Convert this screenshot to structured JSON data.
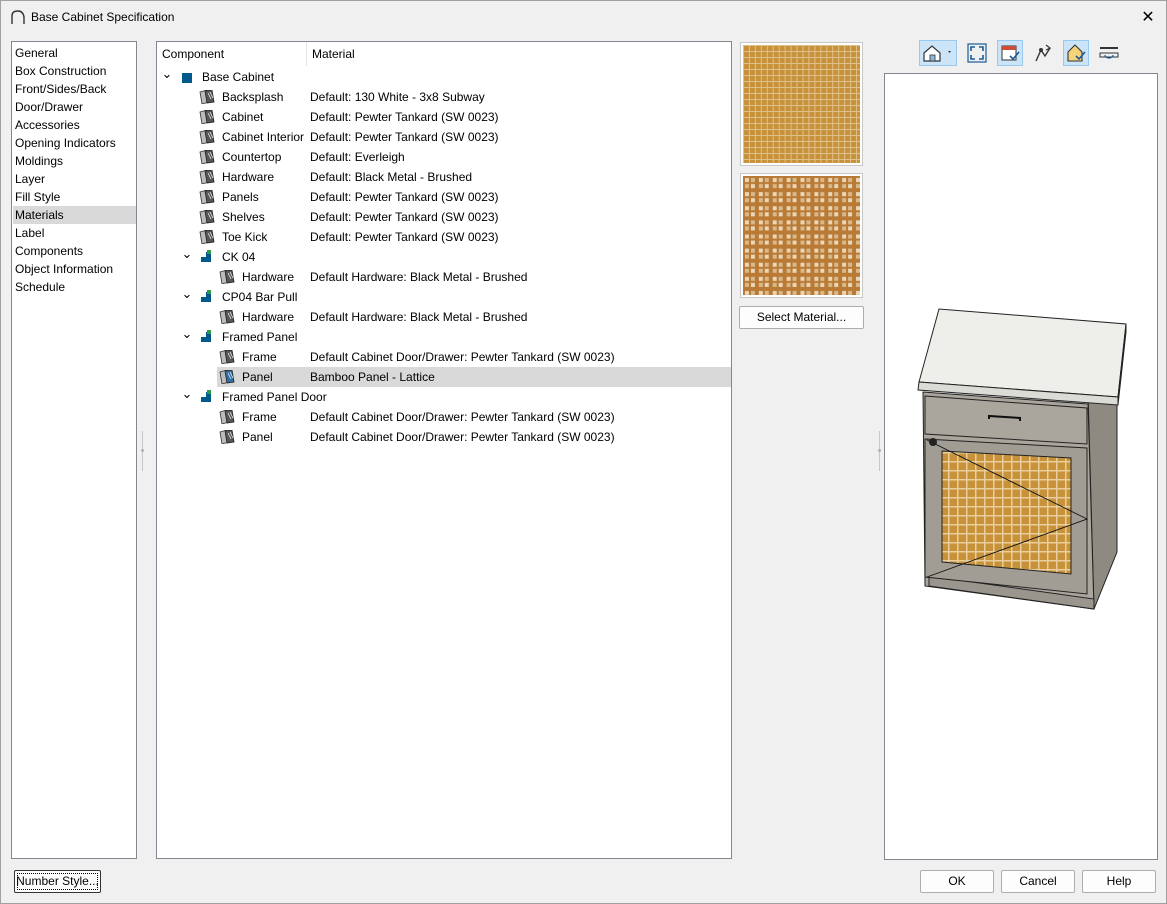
{
  "window": {
    "title": "Base Cabinet Specification",
    "close_glyph": "✕"
  },
  "nav": {
    "items": [
      {
        "label": "General"
      },
      {
        "label": "Box Construction"
      },
      {
        "label": "Front/Sides/Back"
      },
      {
        "label": "Door/Drawer"
      },
      {
        "label": "Accessories"
      },
      {
        "label": "Opening Indicators"
      },
      {
        "label": "Moldings"
      },
      {
        "label": "Layer"
      },
      {
        "label": "Fill Style"
      },
      {
        "label": "Materials",
        "selected": true
      },
      {
        "label": "Label"
      },
      {
        "label": "Components"
      },
      {
        "label": "Object Information"
      },
      {
        "label": "Schedule"
      }
    ]
  },
  "tree": {
    "columns": {
      "component": "Component",
      "material": "Material"
    },
    "rows": [
      {
        "component": "Base Cabinet",
        "material": "",
        "level": 0,
        "icon": "cabinet-icon"
      },
      {
        "component": "Backsplash",
        "material": "Default: 130 White - 3x8 Subway",
        "level": 1,
        "icon": "material-icon"
      },
      {
        "component": "Cabinet",
        "material": "Default: Pewter Tankard (SW 0023)",
        "level": 1,
        "icon": "material-icon"
      },
      {
        "component": "Cabinet Interior",
        "material": "Default: Pewter Tankard (SW 0023)",
        "level": 1,
        "icon": "material-icon"
      },
      {
        "component": "Countertop",
        "material": "Default: Everleigh",
        "level": 1,
        "icon": "material-icon"
      },
      {
        "component": "Hardware",
        "material": "Default: Black Metal - Brushed",
        "level": 1,
        "icon": "material-icon"
      },
      {
        "component": "Panels",
        "material": "Default: Pewter Tankard (SW 0023)",
        "level": 1,
        "icon": "material-icon"
      },
      {
        "component": "Shelves",
        "material": "Default: Pewter Tankard (SW 0023)",
        "level": 1,
        "icon": "material-icon"
      },
      {
        "component": "Toe Kick",
        "material": "Default: Pewter Tankard (SW 0023)",
        "level": 1,
        "icon": "material-icon"
      },
      {
        "component": "CK 04",
        "material": "",
        "level": 1,
        "icon": "component-icon",
        "expanded": true
      },
      {
        "component": "Hardware",
        "material": "Default Hardware: Black Metal - Brushed",
        "level": 2,
        "icon": "material-icon"
      },
      {
        "component": "CP04 Bar Pull",
        "material": "",
        "level": 1,
        "icon": "component-icon",
        "expanded": true
      },
      {
        "component": "Hardware",
        "material": "Default Hardware: Black Metal - Brushed",
        "level": 2,
        "icon": "material-icon"
      },
      {
        "component": "Framed Panel",
        "material": "",
        "level": 1,
        "icon": "component-icon",
        "expanded": true
      },
      {
        "component": "Frame",
        "material": "Default Cabinet Door/Drawer: Pewter Tankard (SW 0023)",
        "level": 2,
        "icon": "material-icon"
      },
      {
        "component": "Panel",
        "material": "Bamboo Panel - Lattice",
        "level": 2,
        "icon": "material-icon-blue",
        "selected": true
      },
      {
        "component": "Framed Panel Door",
        "material": "",
        "level": 1,
        "icon": "component-icon",
        "expanded": true
      },
      {
        "component": "Frame",
        "material": "Default Cabinet Door/Drawer: Pewter Tankard (SW 0023)",
        "level": 2,
        "icon": "material-icon"
      },
      {
        "component": "Panel",
        "material": "Default Cabinet Door/Drawer: Pewter Tankard (SW 0023)",
        "level": 2,
        "icon": "material-icon"
      }
    ]
  },
  "material": {
    "select_label": "Select Material..."
  },
  "preview_toolbar": {
    "buttons": [
      {
        "icon": "camera-view-dropdown-icon",
        "active": true
      },
      {
        "icon": "fill-window-icon",
        "active": false
      },
      {
        "icon": "display-options-icon",
        "active": true
      },
      {
        "icon": "rotate-view-icon",
        "active": false
      },
      {
        "icon": "show-materials-icon",
        "active": true
      },
      {
        "icon": "elevation-icon",
        "active": false
      }
    ]
  },
  "footer": {
    "number_style_label": "Number Style...",
    "ok_label": "OK",
    "cancel_label": "Cancel",
    "help_label": "Help"
  },
  "colors": {
    "accent": "#005a8c",
    "bamboo": "#c8923a",
    "cabinet_body": "#a8a39a",
    "countertop": "#eeeeea"
  }
}
